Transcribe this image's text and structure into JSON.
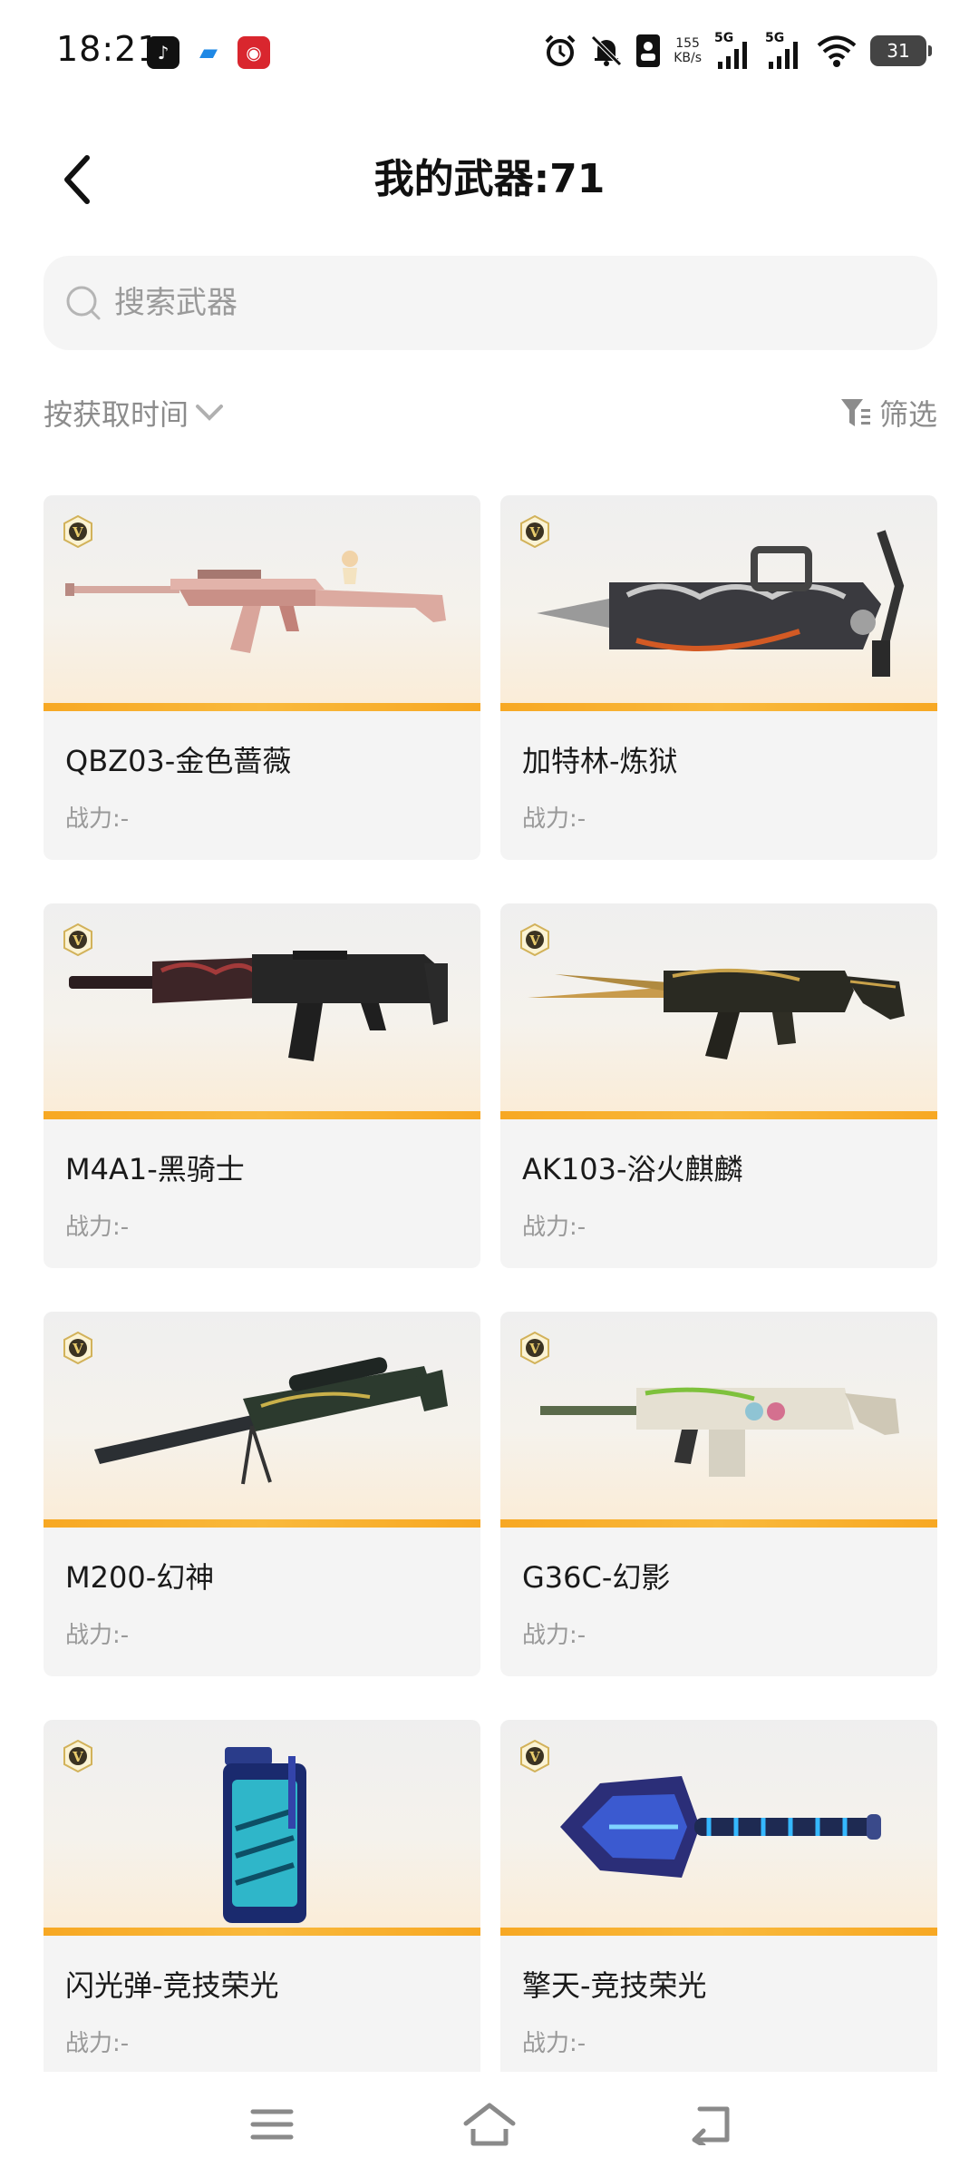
{
  "status_bar": {
    "time": "18:21",
    "net_speed_value": "155",
    "net_speed_unit": "KB/s",
    "signal1_label": "5G",
    "signal2_label": "5G",
    "battery": "31",
    "icons": [
      "tiktok-icon",
      "chat-icon",
      "app-red-icon",
      "alarm-icon",
      "mute-icon",
      "contact-card-icon",
      "signal-icon",
      "signal-icon",
      "wifi-icon",
      "battery-icon"
    ]
  },
  "header": {
    "title": "我的武器:71"
  },
  "search": {
    "placeholder": "搜索武器"
  },
  "sort": {
    "label": "按获取时间"
  },
  "filter": {
    "label": "筛选"
  },
  "colors": {
    "accent_orange": "#f7a823",
    "card_bg": "#f4f4f4",
    "muted_text": "#8c8c8c"
  },
  "weapons": [
    {
      "name": "QBZ03-金色蔷薇",
      "power": "战力:-",
      "badge": "V"
    },
    {
      "name": "加特林-炼狱",
      "power": "战力:-",
      "badge": "V"
    },
    {
      "name": "M4A1-黑骑士",
      "power": "战力:-",
      "badge": "V"
    },
    {
      "name": "AK103-浴火麒麟",
      "power": "战力:-",
      "badge": "V"
    },
    {
      "name": "M200-幻神",
      "power": "战力:-",
      "badge": "V"
    },
    {
      "name": "G36C-幻影",
      "power": "战力:-",
      "badge": "V"
    },
    {
      "name": "闪光弹-竞技荣光",
      "power": "战力:-",
      "badge": "V"
    },
    {
      "name": "擎天-竞技荣光",
      "power": "战力:-",
      "badge": "V"
    }
  ],
  "nav": {
    "buttons": [
      "menu-icon",
      "home-icon",
      "back-icon"
    ]
  }
}
